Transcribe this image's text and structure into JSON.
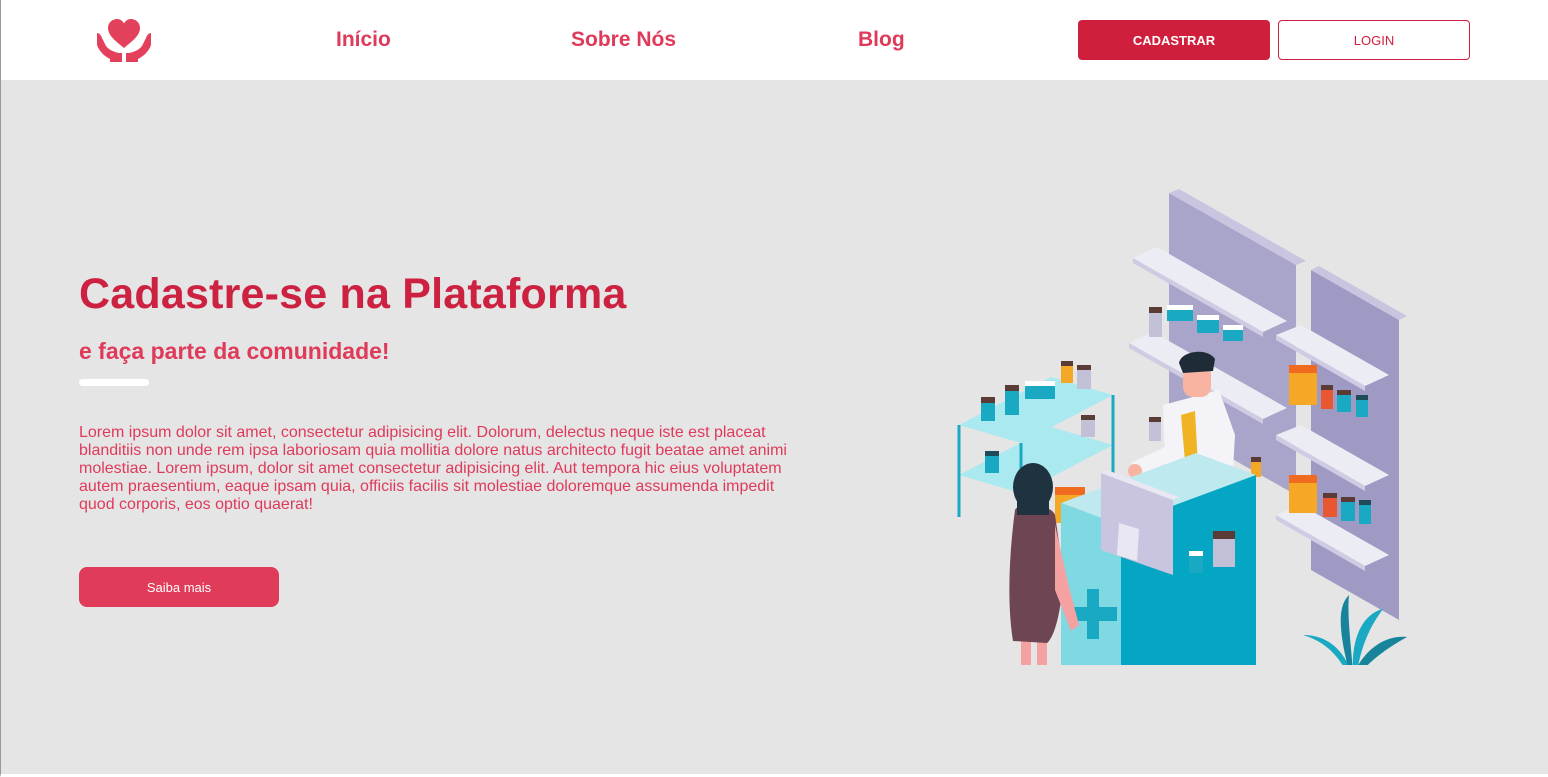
{
  "navbar": {
    "logo_icon": "heart-in-hands-icon",
    "links": [
      {
        "label": "Início"
      },
      {
        "label": "Sobre Nós"
      },
      {
        "label": "Blog"
      }
    ],
    "signup_label": "CADASTRAR",
    "login_label": "LOGIN"
  },
  "hero": {
    "title": "Cadastre-se na Plataforma",
    "subtitle": "e faça parte da comunidade!",
    "text": "Lorem ipsum dolor sit amet, consectetur adipisicing elit. Dolorum, delectus neque iste est placeat blanditiis non unde rem ipsa laboriosam quia mollitia dolore natus architecto fugit beatae amet animi molestiae. Lorem ipsum, dolor sit amet consectetur adipisicing elit. Aut tempora hic eius voluptatem autem praesentium, eaque ipsam quia, officiis facilis sit molestiae doloremque assumenda impedit quod corporis, eos optio quaerat!",
    "cta_label": "Saiba mais",
    "illustration": "pharmacy-counter-illustration"
  },
  "colors": {
    "primary": "#d01f3c",
    "accent": "#e03c59",
    "hero_bg": "#e5e5e5",
    "illustration_teal": "#19a9c3",
    "illustration_lilac": "#a9a4c9"
  }
}
